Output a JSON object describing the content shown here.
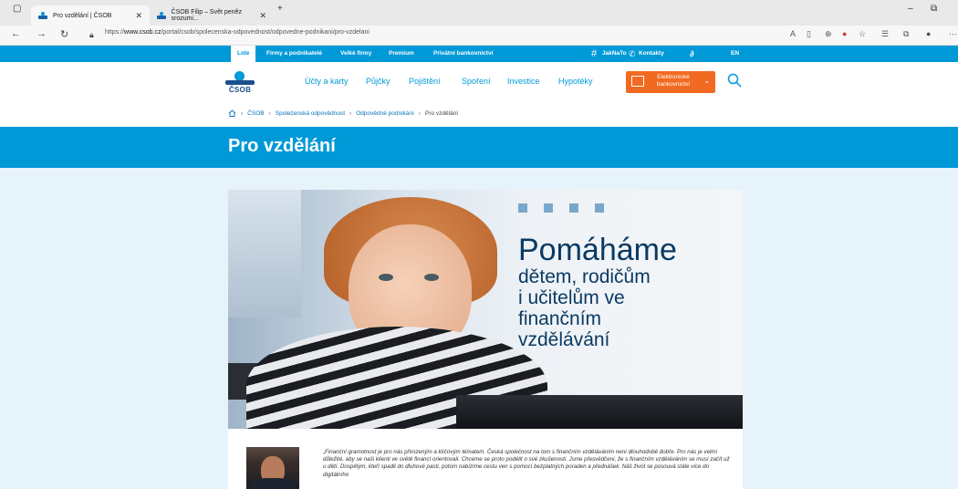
{
  "browser": {
    "tabs": [
      {
        "title": "Pro vzdělání | ČSOB"
      },
      {
        "title": "ČSOB Filip – Svět peněz srozumi..."
      }
    ],
    "url_prefix": "https://",
    "url_host": "www.csob.cz",
    "url_path": "/portal/csob/spolecenska-odpovednost/odpovedne-podnikani/pro-vzdelani"
  },
  "topnav": {
    "items": [
      "Lidé",
      "Firmy a podnikatelé",
      "Velké firmy",
      "Premium",
      "Privátní bankovnictví"
    ],
    "right": [
      "JakNaTo",
      "Kontakty",
      "EN"
    ]
  },
  "header": {
    "logo_text": "ČSOB",
    "menu": [
      "Účty a karty",
      "Půjčky",
      "Pojištění",
      "Spoření",
      "Investice",
      "Hypotéky"
    ],
    "ebanking_label": "Elektronické bankovnictví"
  },
  "breadcrumb": [
    "ČSOB",
    "Společenská odpovědnost",
    "Odpovědné podnikání",
    "Pro vzdělání"
  ],
  "page": {
    "title": "Pro vzdělání"
  },
  "hero": {
    "line1": "Pomáháme",
    "line2": "dětem, rodičům",
    "line3": "i učitelům ve",
    "line4": "finančním",
    "line5": "vzdělávání"
  },
  "quote": {
    "text": "„Finanční gramotnost je pro nás přirozeným a klíčovým tématem. Česká společnost na tom s finančním vzděláváním není dlouhodobě dobře. Pro nás je velmi důležité, aby se naši klienti ve světě financí orientovali. Chceme se proto podělit o své zkušenosti. Jsme přesvědčeni, že s finančním vzděláváním se musí začít už u dětí. Dospělým, kteří spadli do dluhové pasti, potom nabízíme cestu ven s pomocí bezplatných poraden a přednášek. Náš život se posouvá stále více do digitálního"
  },
  "colors": {
    "brand_blue": "#0099d8",
    "dark_blue": "#1a4f8c",
    "orange": "#f26a21"
  }
}
